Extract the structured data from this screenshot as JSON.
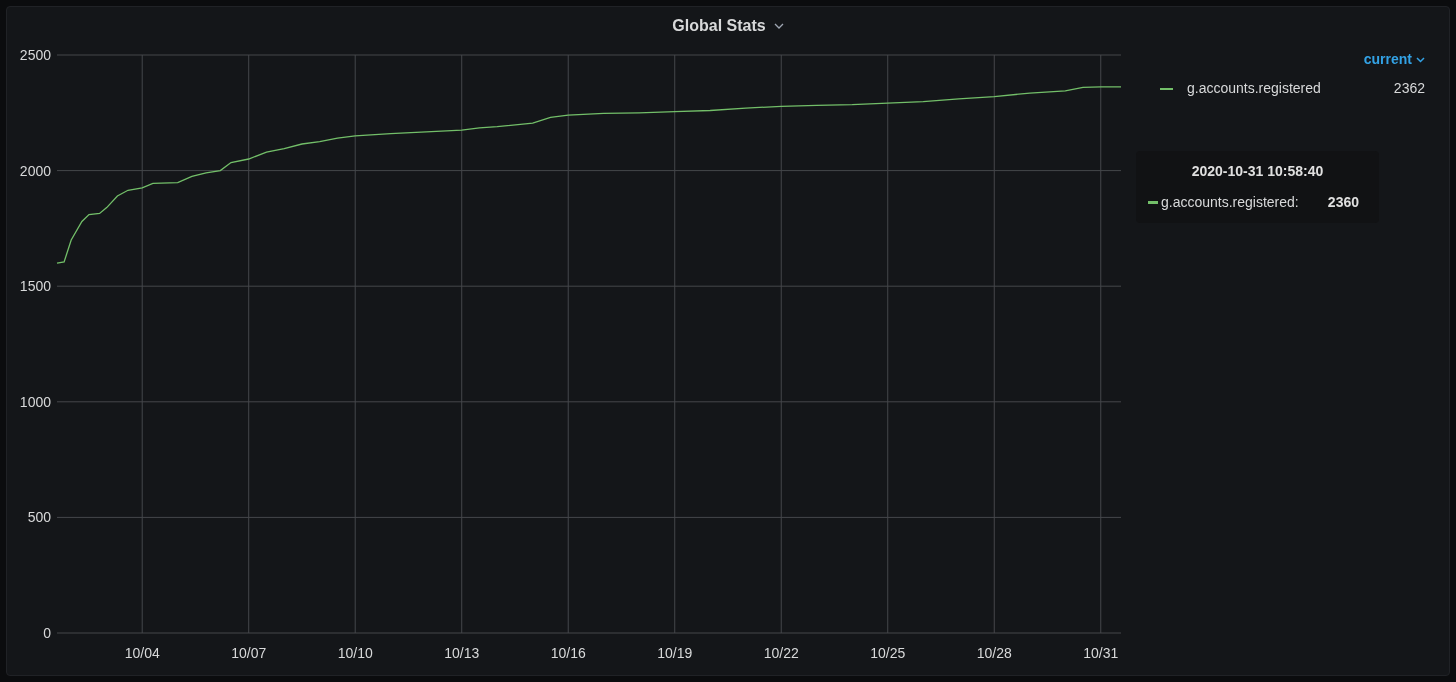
{
  "panel": {
    "title": "Global Stats"
  },
  "chart_data": {
    "type": "line",
    "x": [
      "2020-10-01T14:24",
      "2020-10-01T19:12",
      "2020-10-02T00:00",
      "2020-10-02T07:12",
      "2020-10-02T12:00",
      "2020-10-02T19:12",
      "2020-10-03T00:00",
      "2020-10-03T07:12",
      "2020-10-03T14:24",
      "2020-10-04T00:00",
      "2020-10-04T07:12",
      "2020-10-05T00:00",
      "2020-10-05T09:36",
      "2020-10-05T19:12",
      "2020-10-06T04:48",
      "2020-10-06T12:00",
      "2020-10-07T00:00",
      "2020-10-07T12:00",
      "2020-10-08T00:00",
      "2020-10-08T12:00",
      "2020-10-09T00:00",
      "2020-10-09T12:00",
      "2020-10-10T00:00",
      "2020-10-11T00:00",
      "2020-10-12T00:00",
      "2020-10-13T00:00",
      "2020-10-13T12:00",
      "2020-10-14T00:00",
      "2020-10-15T00:00",
      "2020-10-15T12:00",
      "2020-10-16T00:00",
      "2020-10-17T00:00",
      "2020-10-18T00:00",
      "2020-10-19T00:00",
      "2020-10-20T00:00",
      "2020-10-21T00:00",
      "2020-10-22T00:00",
      "2020-10-23T00:00",
      "2020-10-24T00:00",
      "2020-10-25T00:00",
      "2020-10-26T00:00",
      "2020-10-27T00:00",
      "2020-10-28T00:00",
      "2020-10-29T00:00",
      "2020-10-30T00:00",
      "2020-10-30T12:00",
      "2020-10-31T00:00",
      "2020-10-31T13:41"
    ],
    "series": [
      {
        "name": "g.accounts.registered",
        "color": "#73bf69",
        "values": [
          1600,
          1605,
          1700,
          1780,
          1810,
          1815,
          1840,
          1890,
          1915,
          1925,
          1945,
          1948,
          1975,
          1990,
          2000,
          2035,
          2050,
          2080,
          2095,
          2115,
          2125,
          2140,
          2150,
          2160,
          2168,
          2175,
          2185,
          2190,
          2205,
          2230,
          2240,
          2248,
          2250,
          2255,
          2260,
          2270,
          2278,
          2282,
          2285,
          2292,
          2298,
          2310,
          2320,
          2335,
          2345,
          2360,
          2362,
          2362
        ]
      }
    ],
    "xlim": [
      "2020-10-01T14:24",
      "2020-10-31T13:41"
    ],
    "ylim": [
      0,
      2500
    ],
    "xticks": [
      {
        "value": "2020-10-04T00:00",
        "label": "10/04"
      },
      {
        "value": "2020-10-07T00:00",
        "label": "10/07"
      },
      {
        "value": "2020-10-10T00:00",
        "label": "10/10"
      },
      {
        "value": "2020-10-13T00:00",
        "label": "10/13"
      },
      {
        "value": "2020-10-16T00:00",
        "label": "10/16"
      },
      {
        "value": "2020-10-19T00:00",
        "label": "10/19"
      },
      {
        "value": "2020-10-22T00:00",
        "label": "10/22"
      },
      {
        "value": "2020-10-25T00:00",
        "label": "10/25"
      },
      {
        "value": "2020-10-28T00:00",
        "label": "10/28"
      },
      {
        "value": "2020-10-31T00:00",
        "label": "10/31"
      }
    ],
    "yticks": [
      0,
      500,
      1000,
      1500,
      2000,
      2500
    ],
    "grid": true
  },
  "legend": {
    "sort_label": "current",
    "items": [
      {
        "value": "2362"
      }
    ]
  },
  "tooltip": {
    "time": "2020-10-31 10:58:40",
    "items": [
      {
        "name": "g.accounts.registered:",
        "value": "2360",
        "color": "#73bf69"
      }
    ]
  }
}
